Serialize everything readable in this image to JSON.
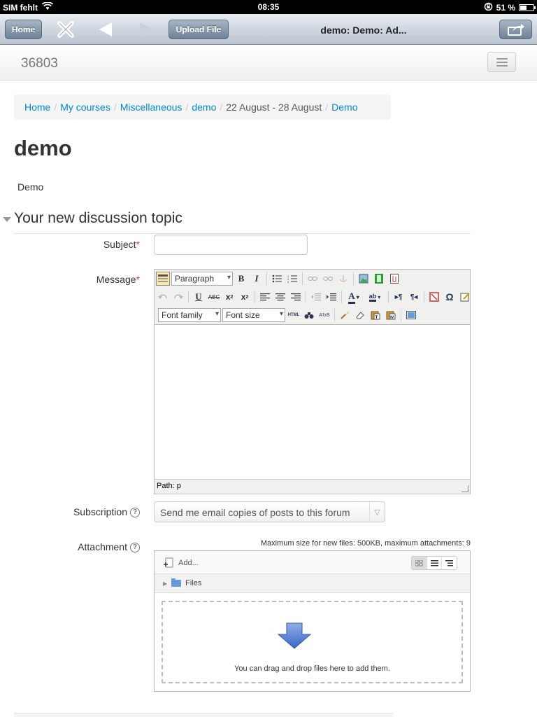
{
  "statusbar": {
    "carrier": "SIM fehlt",
    "time": "08:35",
    "battery": "51 %",
    "battery_level": 0.51
  },
  "browser": {
    "home": "Home",
    "upload": "Upload File",
    "title": "demo: Demo: Ad..."
  },
  "site": {
    "brand": "36803"
  },
  "breadcrumb": {
    "items": [
      "Home",
      "My courses",
      "Miscellaneous",
      "demo",
      "22 August - 28 August",
      "Demo"
    ]
  },
  "page": {
    "heading": "demo",
    "intro": "Demo"
  },
  "form": {
    "legend": "Your new discussion topic",
    "subject_label": "Subject",
    "subject_value": "",
    "message_label": "Message",
    "required_mark": "*",
    "editor": {
      "paragraph": "Paragraph",
      "font_family": "Font family",
      "font_size": "Font size",
      "path": "Path: p"
    },
    "subscription_label": "Subscription",
    "subscription_value": "Send me email copies of posts to this forum",
    "attachment_label": "Attachment",
    "help_mark": "?",
    "max_size": "Maximum size for new files: 500KB, maximum attachments: 9",
    "add": "Add...",
    "files": "Files",
    "dnd": "You can drag and drop files here to add them."
  }
}
